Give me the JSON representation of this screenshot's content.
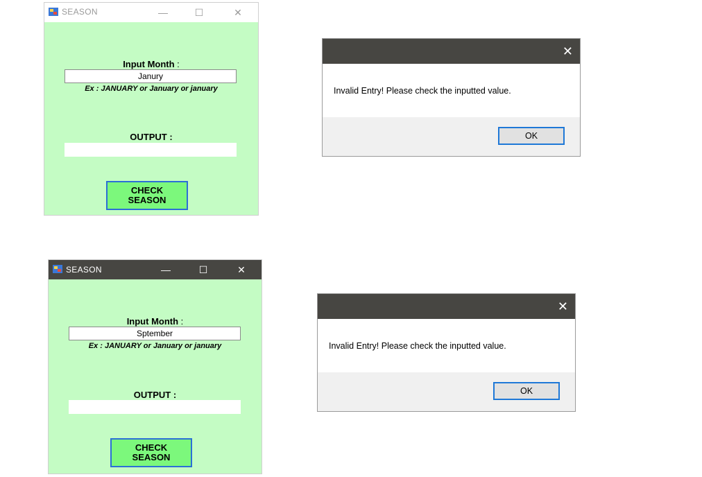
{
  "windows": [
    {
      "title": "SEASON",
      "titlebar_style": "light",
      "controls": {
        "minimize": "—",
        "maximize": "☐",
        "close": "✕"
      },
      "input_label": "Input Month",
      "input_colon": ":",
      "input_value": "Janury",
      "example_text": "Ex : JANUARY or January or january",
      "output_label": "OUTPUT :",
      "output_value": "",
      "button_label_line1": "CHECK",
      "button_label_line2": "SEASON"
    },
    {
      "title": "SEASON",
      "titlebar_style": "dark",
      "controls": {
        "minimize": "—",
        "maximize": "☐",
        "close": "✕"
      },
      "input_label": "Input Month",
      "input_colon": ":",
      "input_value": "Sptember",
      "example_text": "Ex : JANUARY or January or january",
      "output_label": "OUTPUT :",
      "output_value": "",
      "button_label_line1": "CHECK",
      "button_label_line2": "SEASON"
    }
  ],
  "dialogs": [
    {
      "message": "Invalid Entry! Please check the inputted value.",
      "ok_label": "OK",
      "close_glyph": "✕"
    },
    {
      "message": "Invalid Entry! Please check the inputted value.",
      "ok_label": "OK",
      "close_glyph": "✕"
    }
  ],
  "colors": {
    "form_background": "#c4fcc4",
    "button_background": "#7cf87c",
    "button_border": "#2b6fd6",
    "dark_titlebar": "#474642",
    "dialog_footer": "#f0f0f0",
    "ok_border": "#1e78d7"
  }
}
